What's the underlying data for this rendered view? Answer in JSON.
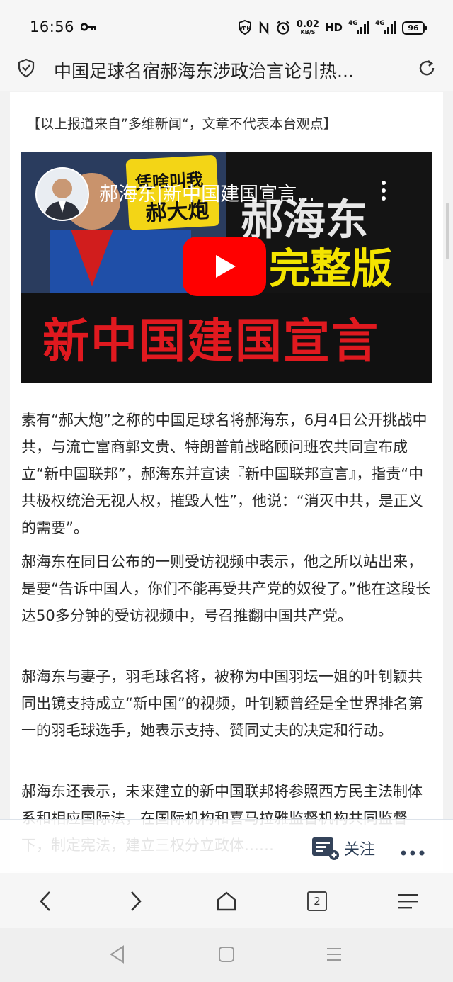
{
  "status_bar": {
    "time": "16:56",
    "net_speed_value": "0.02",
    "net_speed_unit": "KB/S",
    "hd_label": "HD",
    "signal_1_label": "4G",
    "signal_2_label": "4G",
    "battery": "96"
  },
  "address_bar": {
    "title": "中国足球名宿郝海东涉政治言论引热..."
  },
  "article": {
    "source_note": "【以上报道来自”多维新闻“，文章不代表本台观点】",
    "video": {
      "title": "郝海东|新中国建国宣言...",
      "overlay_sign_line1": "凭啥叫我",
      "overlay_sign_line2": "郝大炮",
      "overlay_name": "郝海东",
      "overlay_complete": "完整版",
      "overlay_declaration": "新中国建国宣言"
    },
    "paragraphs": [
      "素有“郝大炮”之称的中国足球名将郝海东，6月4日公开挑战中共，与流亡富商郭文贵、特朗普前战略顾问班农共同宣布成立“新中国联邦”，郝海东并宣读『新中国联邦宣言』，指责“中共极权统治无视人权，摧毁人性”，他说：“消灭中共，是正义的需要”。",
      "郝海东在同日公布的一则受访视频中表示，他之所以站出来， 是要“告诉中国人，你们不能再受共产党的奴役了。”他在这段长达50多分钟的受访视频中，号召推翻中国共产党。",
      "郝海东与妻子，羽毛球名将，被称为中国羽坛一姐的叶钊颖共同出镜支持成立“新中国”的视频，叶钊颖曾经是全世界排名第一的羽毛球选手，她表示支持、赞同丈夫的决定和行动。",
      "郝海东还表示，未来建立的新中国联邦将参照西方民主法制体系和相应国际法，在国际机构和喜马拉雅监督机构共同监督下，制定宪法，建立三权分立政体……"
    ]
  },
  "follow_bar": {
    "follow_label": "关注"
  },
  "bottom_nav": {
    "tab_count": "2"
  }
}
